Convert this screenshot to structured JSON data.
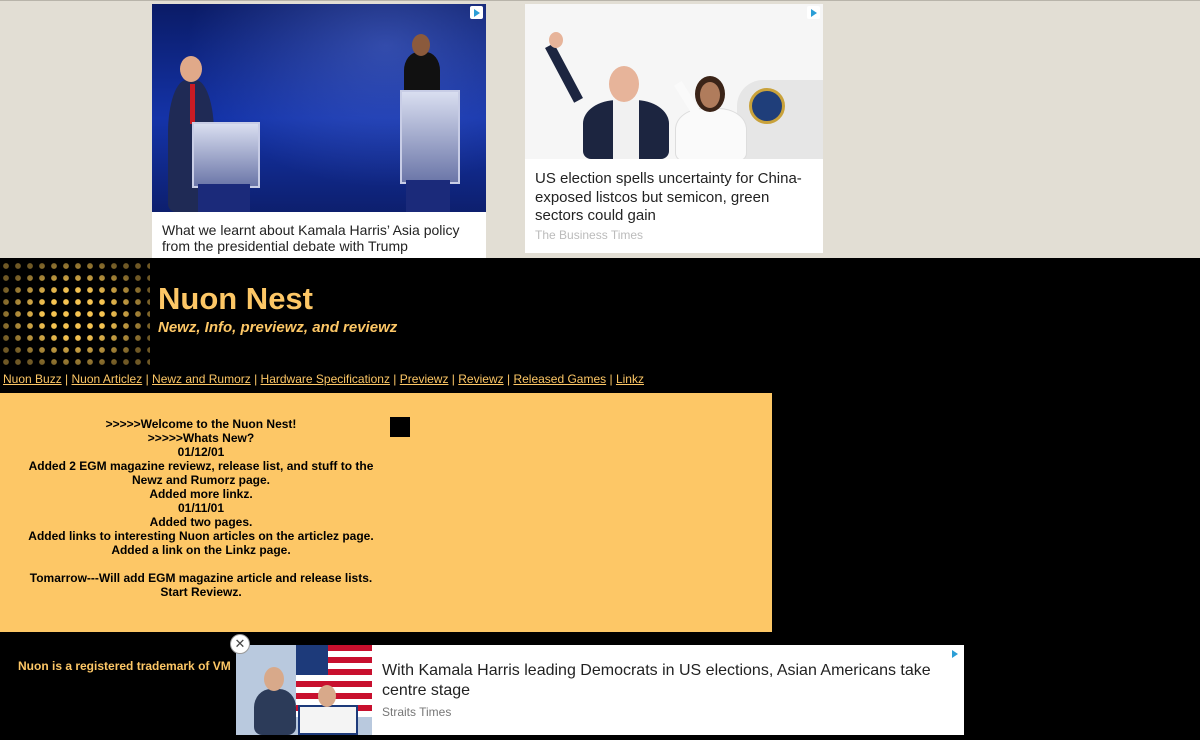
{
  "ads": {
    "top_left": {
      "headline": "What we learnt about Kamala Harris’ Asia policy from the presidential debate with Trump",
      "icon": "adchoices-icon"
    },
    "top_right": {
      "headline": "US election spells uncertainty for China-exposed listcos but semicon, green sectors could gain",
      "source": "The Business Times",
      "icon": "adchoices-icon"
    },
    "bottom": {
      "headline": "With Kamala Harris leading Democrats in US elections, Asian Americans take centre stage",
      "source": "Straits Times",
      "close_label": "✕",
      "icon": "adchoices-icon"
    }
  },
  "site": {
    "title": "Nuon Nest",
    "tagline": "Newz, Info, previewz, and reviewz",
    "accent_color": "#fdc766"
  },
  "nav": {
    "items": [
      "Nuon Buzz",
      "Nuon Articlez",
      "Newz and Rumorz",
      "Hardware Specificationz",
      "Previewz",
      "Reviewz",
      "Released Games",
      "Linkz"
    ],
    "separator": "|"
  },
  "news": {
    "lines": [
      ">>>>>Welcome to the Nuon Nest!",
      ">>>>>Whats New?",
      "01/12/01",
      "Added 2 EGM magazine reviewz, release list, and stuff to the",
      "Newz and Rumorz page.",
      "Added more linkz.",
      "01/11/01",
      "Added two pages.",
      "Added links to interesting Nuon articles on the articlez page.",
      "Added a link on the Linkz page.",
      "",
      "Tomarrow---Will add EGM magazine article and release lists.",
      "Start Reviewz."
    ]
  },
  "footer": {
    "trademark": "Nuon is a registered trademark of VM"
  }
}
